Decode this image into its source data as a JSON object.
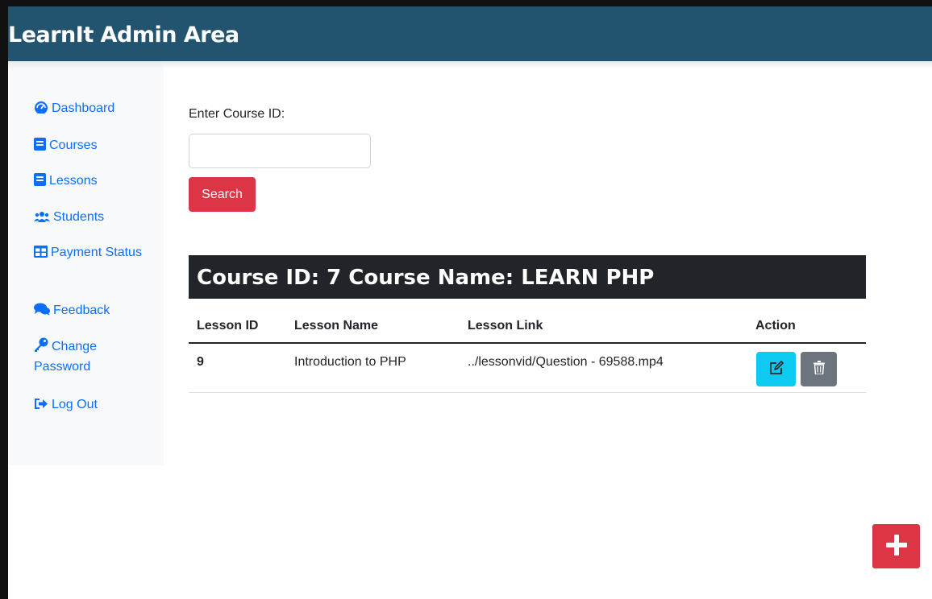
{
  "brand": {
    "title": "LearnIt Admin Area"
  },
  "sidebar": {
    "items": [
      {
        "label": "Dashboard",
        "icon": "tachometer-icon"
      },
      {
        "label": "Courses",
        "icon": "book-icon"
      },
      {
        "label": "Lessons",
        "icon": "book-icon"
      },
      {
        "label": "Students",
        "icon": "users-icon"
      },
      {
        "label": "Payment Status",
        "icon": "table-icon"
      },
      {
        "label": "Feedback",
        "icon": "comments-icon"
      },
      {
        "label": "Change Password",
        "icon": "key-icon"
      },
      {
        "label": "Log Out",
        "icon": "sign-out-icon"
      }
    ]
  },
  "search": {
    "label": "Enter Course ID:",
    "value": "",
    "button_label": "Search"
  },
  "course": {
    "heading": "Course ID: 7 Course Name: LEARN PHP"
  },
  "table": {
    "headers": [
      "Lesson ID",
      "Lesson Name",
      "Lesson Link",
      "Action"
    ],
    "rows": [
      {
        "id": "9",
        "name": "Introduction to PHP",
        "link": "../lessonvid/Question - 69588.mp4"
      }
    ]
  },
  "colors": {
    "navbar": "#225470",
    "link": "#0d6efd",
    "danger": "#dc3545",
    "info": "#0dcaf0",
    "secondary": "#6c757d",
    "dark": "#212529"
  }
}
